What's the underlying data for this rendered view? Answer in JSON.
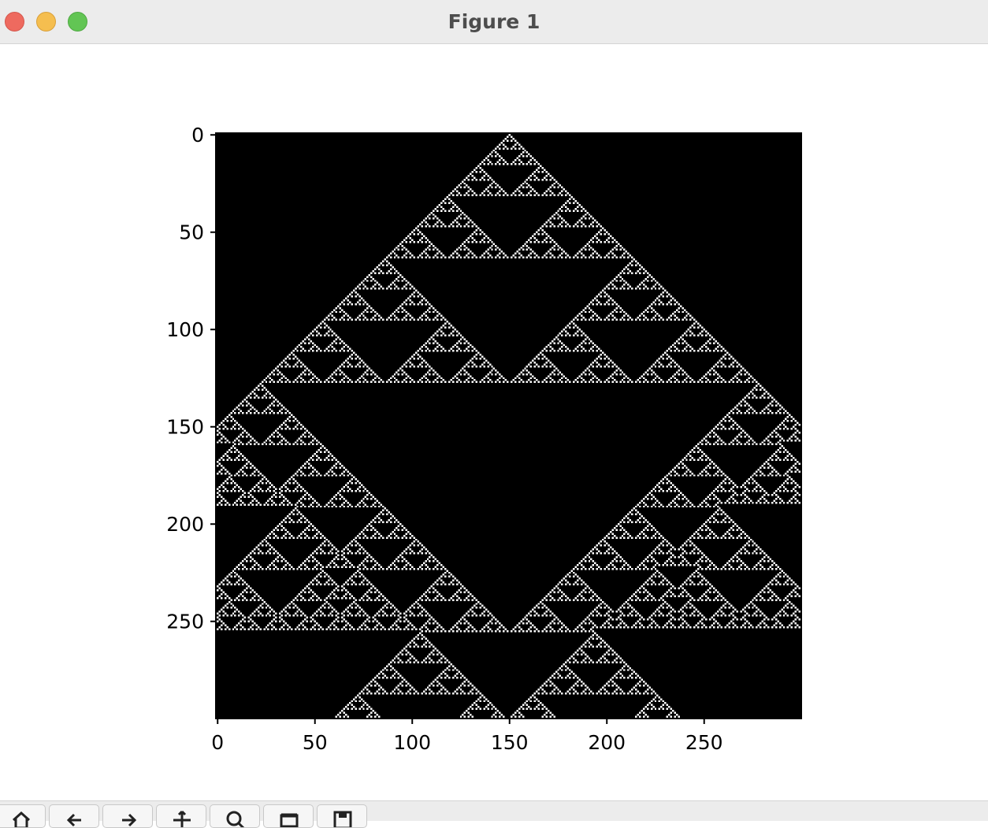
{
  "window": {
    "title": "Figure 1"
  },
  "toolbar": {
    "buttons": [
      {
        "icon": "home-icon"
      },
      {
        "icon": "back-arrow-icon"
      },
      {
        "icon": "forward-arrow-icon"
      },
      {
        "icon": "pan-icon"
      },
      {
        "icon": "zoom-icon"
      },
      {
        "icon": "configure-subplots-icon"
      },
      {
        "icon": "save-icon"
      }
    ]
  },
  "chart_data": {
    "type": "heatmap",
    "description_rule": "Elementary cellular automaton Rule 90 (XOR of neighbors), started from one cell at column 150, rows 0-299, 300 columns; 1 = white, 0 = black",
    "rule": 90,
    "rows": 300,
    "cols": 300,
    "seed_col": 150,
    "colors": {
      "on": "#ffffff",
      "off": "#000000"
    },
    "x_ticks": [
      0,
      50,
      100,
      150,
      200,
      250
    ],
    "y_ticks": [
      0,
      50,
      100,
      150,
      200,
      250
    ],
    "x_tick_labels": [
      "0",
      "50",
      "100",
      "150",
      "200",
      "250"
    ],
    "y_tick_labels": [
      "0",
      "50",
      "100",
      "150",
      "200",
      "250"
    ],
    "xlim": [
      0,
      300
    ],
    "ylim": [
      300,
      0
    ],
    "title": "",
    "xlabel": "",
    "ylabel": ""
  }
}
